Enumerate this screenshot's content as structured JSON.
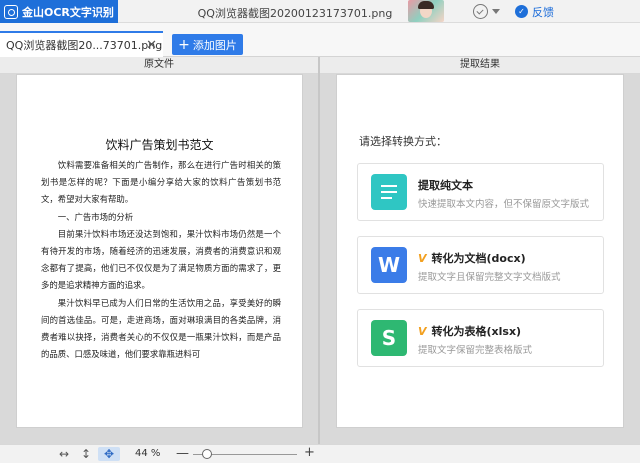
{
  "app": {
    "name": "金山OCR文字识别",
    "window_title": "QQ浏览器截图20200123173701.png",
    "feedback_label": "反馈",
    "feedback_icon": "chat-bubble-icon",
    "brand_color": "#1e6fd9"
  },
  "tabs": {
    "active_file": "QQ浏览器截图20...73701.png",
    "close_glyph": "✕",
    "add_button_icon": "+",
    "add_button_label": "添加图片"
  },
  "panels": {
    "left_header": "原文件",
    "right_header": "提取结果"
  },
  "document": {
    "title": "饮料广告策划书范文",
    "paragraphs": [
      "饮料需要准备相关的广告制作，那么在进行广告时相关的策划书是怎样的呢？下面是小编分享给大家的饮料广告策划书范文，希望对大家有帮助。",
      "一、广告市场的分析",
      "目前果汁饮料市场还没达到饱和，果汁饮料市场仍然是一个有待开发的市场，随着经济的迅速发展，消费者的消费意识和观念都有了提高，他们已不仅仅是为了满足物质方面的需求了，更多的是追求精神方面的追求。",
      "果汁饮料早已成为人们日常的生活饮用之品，享受美好的瞬间的首选佳品。可是，走进商场，面对琳琅满目的各类品牌，消费者难以抉择，消费者关心的不仅仅是一瓶果汁饮料，而是产品的品质、口感及味道，他们要求靠瓶进料可"
    ]
  },
  "result": {
    "prompt": "请选择转换方式：",
    "options": [
      {
        "label": "提取纯文本",
        "desc": "快速提取本文内容，但不保留原文字版式",
        "icon": "text-lines-icon",
        "vip": ""
      },
      {
        "label": "转化为文档(docx)",
        "desc": "提取文字且保留完整文字文档版式",
        "icon": "word-icon",
        "icon_letter": "W",
        "vip": "V"
      },
      {
        "label": "转化为表格(xlsx)",
        "desc": "提取文字保留完整表格版式",
        "icon": "sheet-icon",
        "icon_letter": "S",
        "vip": "V"
      }
    ]
  },
  "bottombar": {
    "fit_width_glyph": "↔",
    "fit_height_glyph": "↕",
    "pan_glyph": "✥",
    "zoom_value": "44 %",
    "zoom_minus": "—",
    "zoom_plus": "+",
    "zoom_fraction": 0.1
  }
}
